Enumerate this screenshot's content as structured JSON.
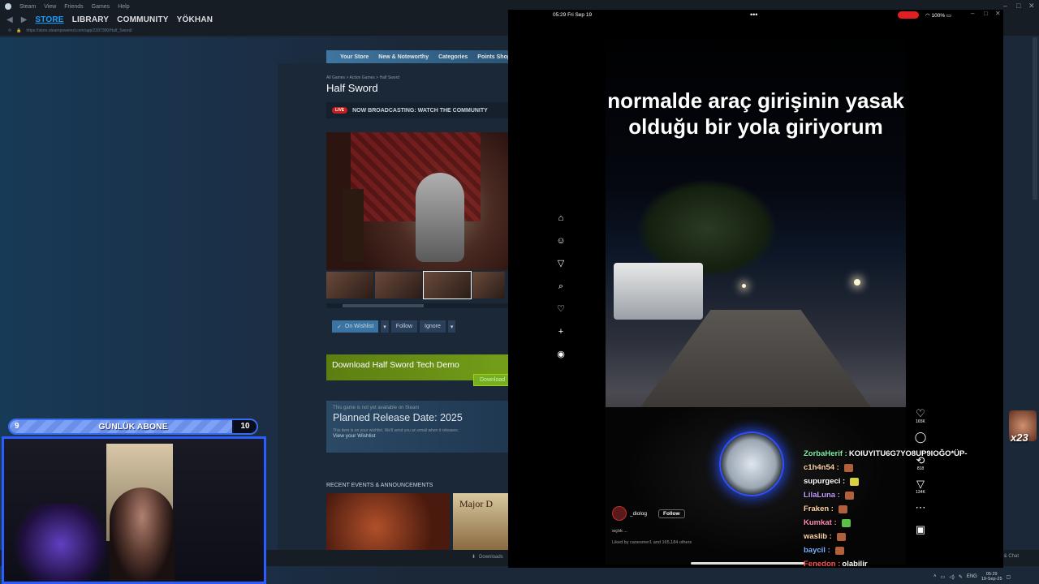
{
  "steam": {
    "menu": [
      "Steam",
      "View",
      "Friends",
      "Games",
      "Help"
    ],
    "nav_tabs": [
      "STORE",
      "LIBRARY",
      "COMMUNITY",
      "YÖKHAN"
    ],
    "url": "https://store.steampowered.com/app/2397300/Half_Sword/",
    "store_menu": [
      "Your Store",
      "New & Noteworthy",
      "Categories",
      "Points Shop"
    ],
    "breadcrumb": "All Games > Action Games > Half Sword",
    "game_title": "Half Sword",
    "live_badge": "LIVE",
    "broadcast_text": "NOW BROADCASTING: WATCH THE COMMUNITY",
    "actions": {
      "wishlist": "On Wishlist",
      "follow": "Follow",
      "ignore": "Ignore"
    },
    "download_title": "Download Half Sword Tech Demo",
    "download_button": "Download",
    "release": {
      "note": "This game is not yet available on Steam",
      "date": "Planned Release Date: 2025",
      "wishlist_note": "This item is on your wishlist. We'll send you an email when it releases.",
      "wishlist_link": "View your Wishlist"
    },
    "events_heading": "RECENT EVENTS & ANNOUNCEMENTS",
    "event_banner": "Major D",
    "downloads_label": "Downloads",
    "friends_chat": "s & Chat"
  },
  "phone": {
    "status_time": "05:29  Fri Sep 19",
    "battery": "100%",
    "caption": "normalde araç girişinin yasak olduğu bir yola giriyorum",
    "side_nav_icons": [
      "home-icon",
      "friends-icon",
      "explore-icon",
      "search-icon",
      "heart-icon",
      "plus-icon",
      "profile-icon"
    ],
    "stats": {
      "likes": "165K",
      "comments": "",
      "reposts": "818",
      "shares": "134K"
    },
    "author": "_diolog",
    "follow_label": "Follow",
    "description": "sıçtık ...",
    "liked_by": "Liked by canesmer1 and 165,184 others"
  },
  "chat": [
    {
      "user": "ZorbaHerif :",
      "msg": "KOIUYITU6G7YO8UP9IOĞO*ÜP-",
      "color": "#7cf0a8",
      "emote": ""
    },
    {
      "user": "c1h4n54 :",
      "msg": "",
      "color": "#ffd2a0",
      "emote": "#b0603a"
    },
    {
      "user": "supurgeci :",
      "msg": "",
      "color": "#ffffff",
      "emote": "#d8d040"
    },
    {
      "user": "LilaLuna :",
      "msg": "",
      "color": "#c39cff",
      "emote": "#b0603a"
    },
    {
      "user": "Fraken :",
      "msg": "",
      "color": "#ffd2a0",
      "emote": "#b0603a"
    },
    {
      "user": "Kumkat :",
      "msg": "",
      "color": "#ff8ab0",
      "emote": "#5ac04a"
    },
    {
      "user": "waslib :",
      "msg": "",
      "color": "#ffd2a0",
      "emote": "#b0603a"
    },
    {
      "user": "baycil :",
      "msg": "",
      "color": "#7ab0ff",
      "emote": "#b0603a"
    },
    {
      "user": "Fenedon :",
      "msg": "olabilir",
      "color": "#ff5050",
      "emote": ""
    }
  ],
  "sub_goal": {
    "current": "9",
    "label": "GÜNLÜK ABONE",
    "goal": "10",
    "progress": 0.9
  },
  "emote_counter": "x23",
  "taskbar": {
    "lang": "ENG",
    "time": "05:29",
    "date": "19-Sep-25"
  },
  "colors": {
    "steam_accent": "#1a9fff",
    "store_bg": "#1b2838",
    "download_green": "#75a01a",
    "cam_border": "#2a5cff",
    "live_red": "#c51f1f"
  }
}
